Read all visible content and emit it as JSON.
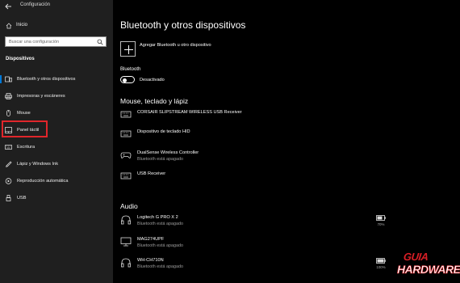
{
  "window": {
    "title": "Configuración"
  },
  "sidebar": {
    "home_label": "Inicio",
    "search_placeholder": "Buscar una configuración",
    "section_label": "Dispositivos",
    "items": [
      {
        "label": "Bluetooth y otros dispositivos",
        "icon": "bluetooth-devices-icon",
        "active": true
      },
      {
        "label": "Impresoras y escáneres",
        "icon": "printer-icon"
      },
      {
        "label": "Mouse",
        "icon": "mouse-icon"
      },
      {
        "label": "Panel táctil",
        "icon": "touchpad-icon"
      },
      {
        "label": "Escritura",
        "icon": "keyboard-icon"
      },
      {
        "label": "Lápiz y Windows Ink",
        "icon": "pen-icon"
      },
      {
        "label": "Reproducción automática",
        "icon": "autoplay-icon"
      },
      {
        "label": "USB",
        "icon": "usb-icon"
      }
    ]
  },
  "main": {
    "title": "Bluetooth y otros dispositivos",
    "add_device_label": "Agregar Bluetooth u otro dispositivo",
    "bluetooth_label": "Bluetooth",
    "bluetooth_state": "Desactivado",
    "groups": {
      "input": {
        "heading": "Mouse, teclado y lápiz",
        "devices": [
          {
            "name": "CORSAIR SLIPSTREAM WIRELESS USB Receiver",
            "status": "",
            "icon": "keyboard-icon"
          },
          {
            "name": "Dispositivo de teclado HID",
            "status": "",
            "icon": "keyboard-icon"
          },
          {
            "name": "DualSense Wireless Controller",
            "status": "Bluetooth está apagado",
            "icon": "gamepad-icon"
          },
          {
            "name": "USB Receiver",
            "status": "",
            "icon": "keyboard-icon"
          }
        ]
      },
      "audio": {
        "heading": "Audio",
        "devices": [
          {
            "name": "Logitech G PRO X 2",
            "status": "Bluetooth está apagado",
            "icon": "headset-icon",
            "battery": "70%"
          },
          {
            "name": "MAG274UPF",
            "status": "Bluetooth está apagado",
            "icon": "monitor-icon"
          },
          {
            "name": "WH-CH710N",
            "status": "Bluetooth está apagado",
            "icon": "headset-icon",
            "battery": "100%"
          }
        ]
      }
    }
  },
  "watermark": {
    "top": "GUIA",
    "bottom": "HARDWARE"
  },
  "colors": {
    "accent": "#0078d7",
    "highlight": "#e0262b",
    "sidebar_bg": "#1f1f1f",
    "main_bg": "#000000"
  }
}
